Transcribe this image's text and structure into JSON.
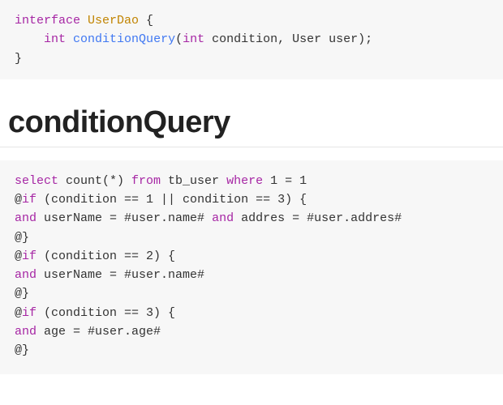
{
  "code1": {
    "interface_kw": "interface",
    "interface_name": "UserDao",
    "open_brace": " {",
    "indent": "    ",
    "return_type": "int",
    "method_name": "conditionQuery",
    "params_open": "(",
    "param1_type": "int",
    "param1_name": " condition, User user",
    "params_close": ");",
    "close_brace": "}"
  },
  "heading": "conditionQuery",
  "code2": {
    "l1_a": "select",
    "l1_b": " count(*) ",
    "l1_c": "from",
    "l1_d": " tb_user ",
    "l1_e": "where",
    "l1_f": " 1 = 1",
    "l2_a": "@",
    "l2_b": "if",
    "l2_c": " (condition == 1 || condition == 3) {",
    "l3_a": "and",
    "l3_b": " userName = #user.name# ",
    "l3_c": "and",
    "l3_d": " addres = #user.addres#",
    "l4": "@}",
    "l5_a": "@",
    "l5_b": "if",
    "l5_c": " (condition == 2) {",
    "l6_a": "and",
    "l6_b": " userName = #user.name#",
    "l7": "@}",
    "l8_a": "@",
    "l8_b": "if",
    "l8_c": " (condition == 3) {",
    "l9_a": "and",
    "l9_b": " age = #user.age#",
    "l10": "@}"
  }
}
